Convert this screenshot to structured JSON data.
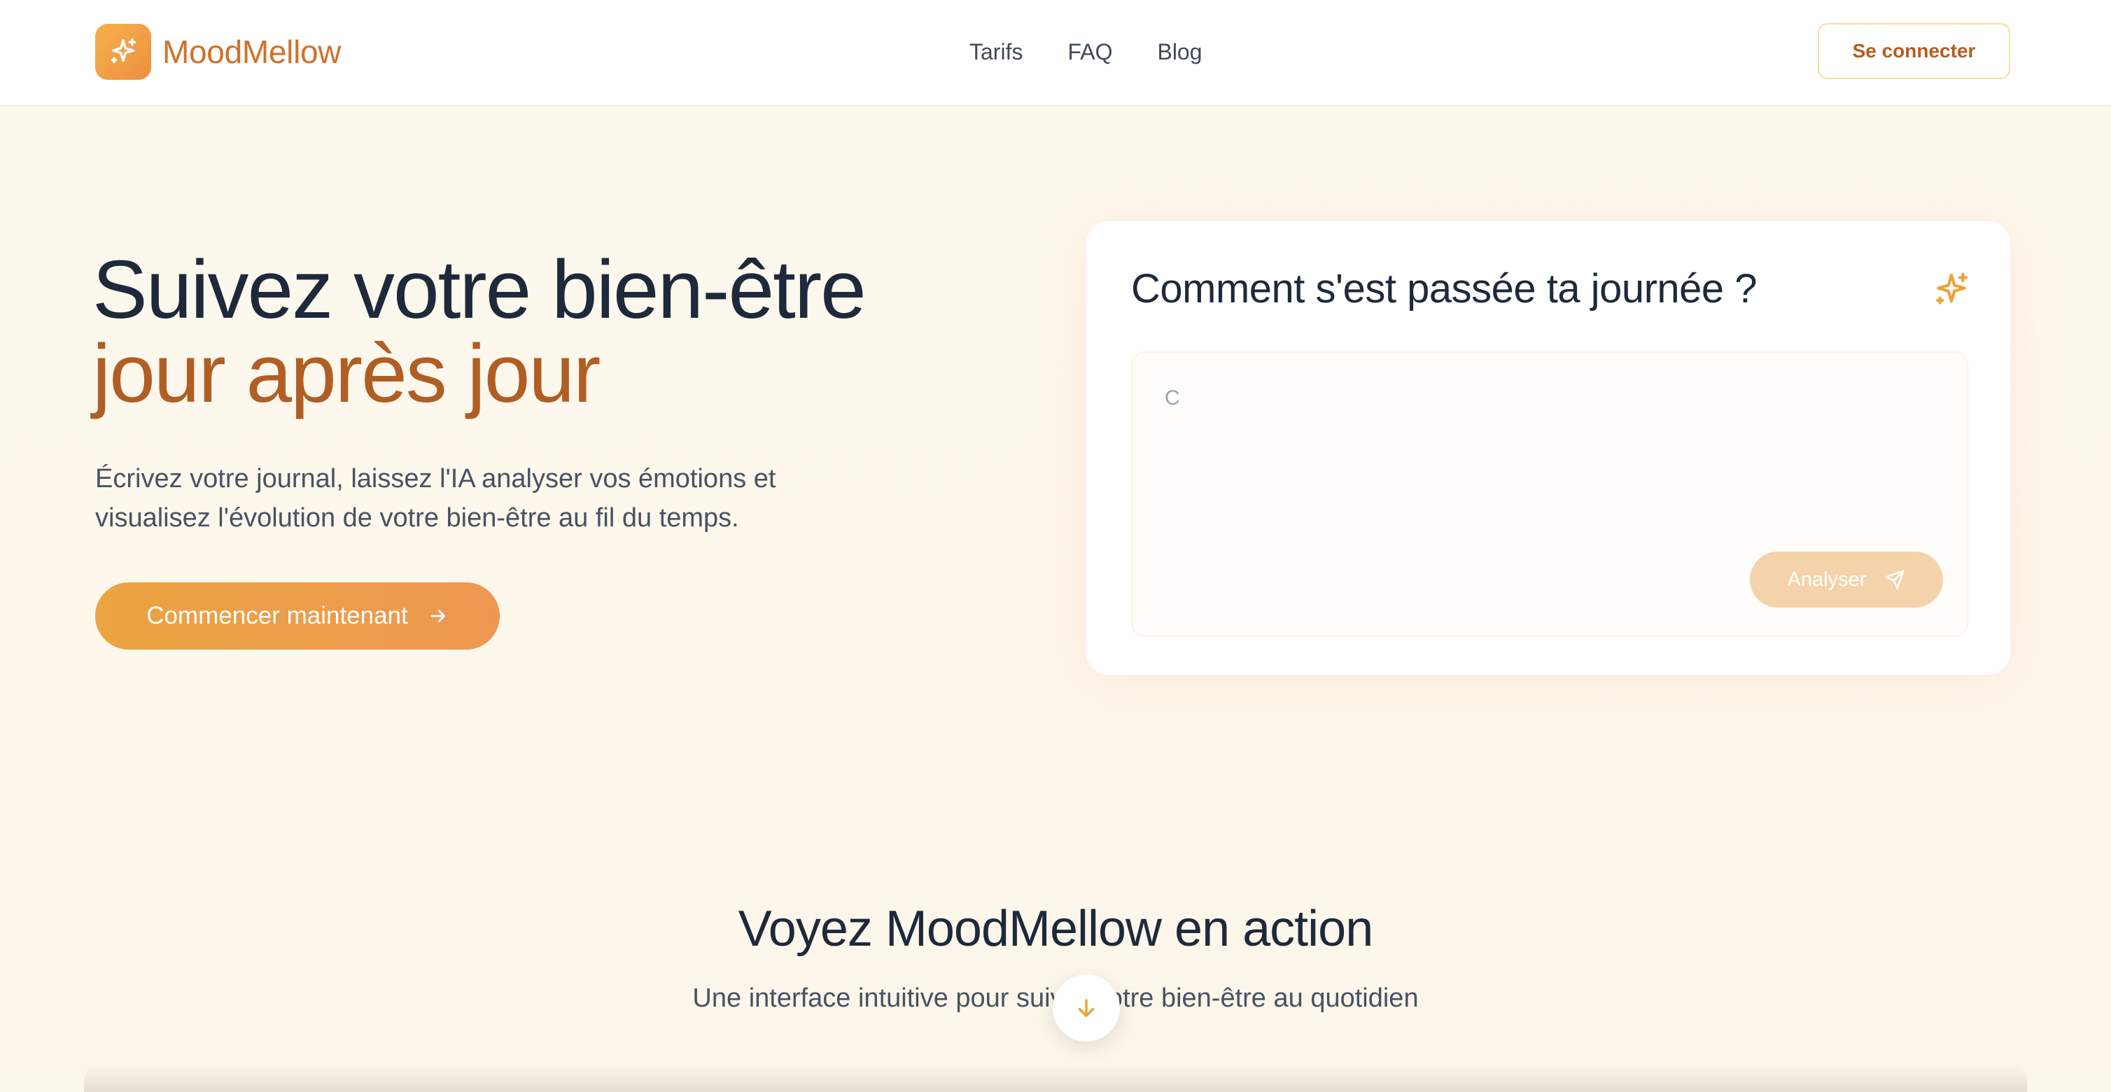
{
  "header": {
    "logo_icon": "sparkles-icon",
    "brand": "MoodMellow",
    "nav": [
      {
        "label": "Tarifs"
      },
      {
        "label": "FAQ"
      },
      {
        "label": "Blog"
      }
    ],
    "login_label": "Se connecter"
  },
  "hero": {
    "title_line1": "Suivez votre bien-être",
    "title_line2": "jour après jour",
    "description": "Écrivez votre journal, laissez l'IA analyser vos émotions et visualisez l'évolution de votre bien-être au fil du temps.",
    "cta_label": "Commencer maintenant",
    "cta_icon": "arrow-right-icon"
  },
  "journal_card": {
    "title": "Comment s'est passée ta journée ?",
    "sparkle_icon": "sparkles-icon",
    "textarea_value": "C",
    "analyze_label": "Analyser",
    "analyze_icon": "send-icon"
  },
  "demo_section": {
    "title": "Voyez MoodMellow en action",
    "subtitle": "Une interface intuitive pour suivre votre bien-être au quotidien",
    "scroll_icon": "arrow-down-icon"
  },
  "colors": {
    "brand": "#d0712a",
    "accent_gradient_start": "#eba440",
    "accent_gradient_end": "#ee9752",
    "hero_highlight": "#b05e24",
    "analyze_disabled": "#f4d3ab"
  }
}
